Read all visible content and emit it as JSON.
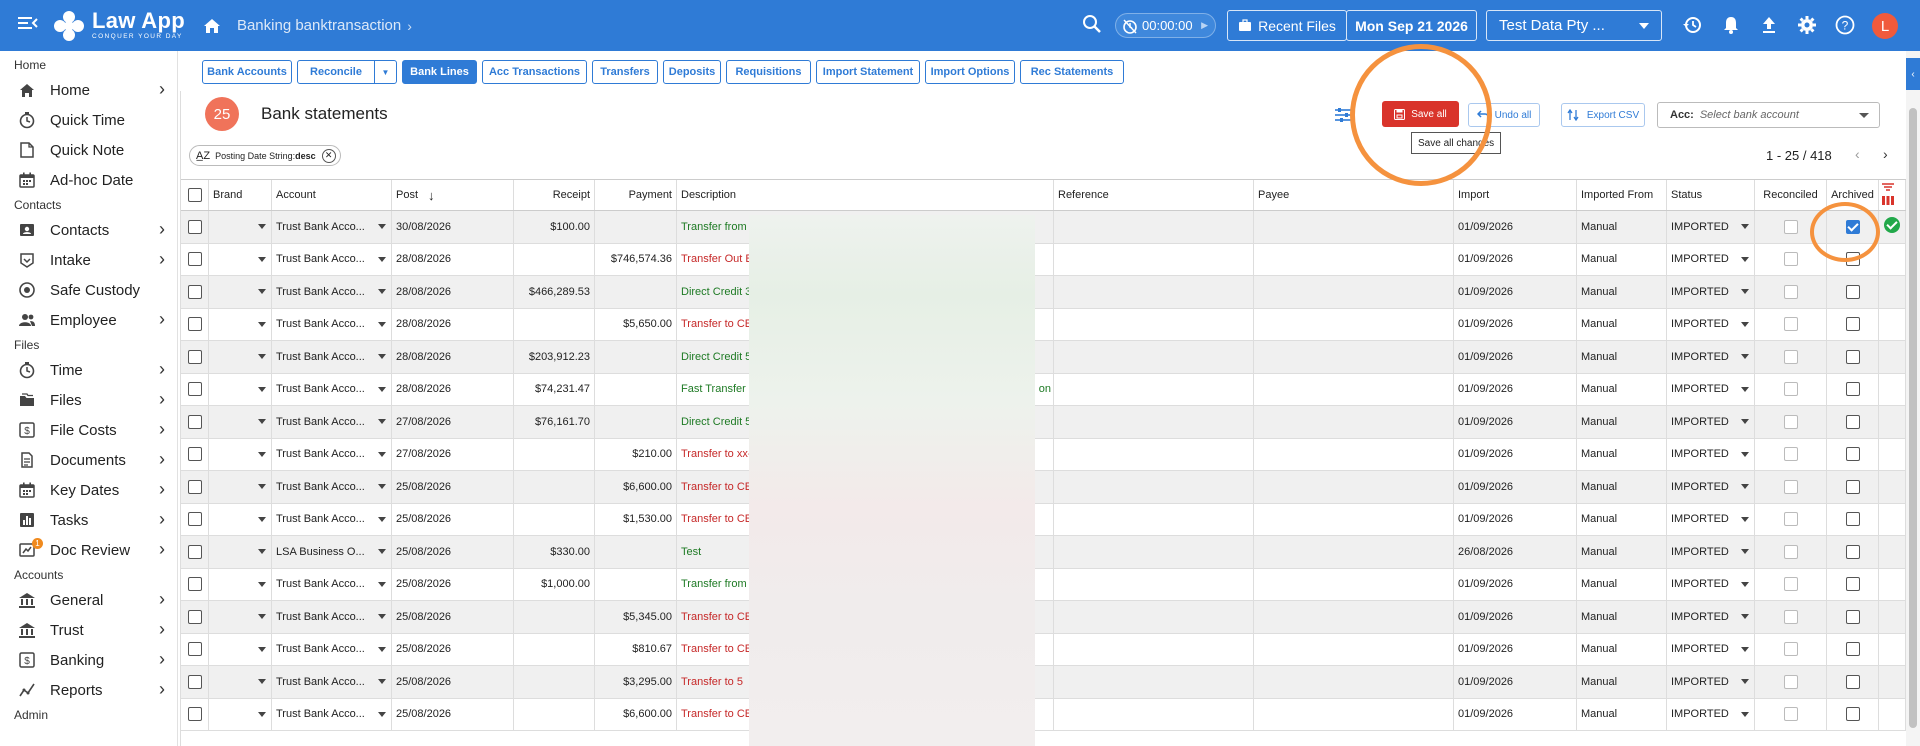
{
  "topbar": {
    "logo_name": "Law App",
    "logo_tagline": "CONQUER YOUR DAY",
    "breadcrumb": "Banking banktransaction",
    "timer": "00:00:00",
    "recent_files": "Recent Files",
    "date": "Mon Sep 21 2026",
    "company": "Test Data Pty ...",
    "avatar_initial": "L",
    "icons": [
      "menu-icon",
      "home-icon",
      "search-icon",
      "timer-icon",
      "history-icon",
      "bell-icon",
      "upload-icon",
      "gear-icon",
      "help-icon"
    ]
  },
  "sidebar": {
    "sections": [
      {
        "title": "Home",
        "items": [
          {
            "label": "Home",
            "icon": "home-icon",
            "chevron": true
          },
          {
            "label": "Quick Time",
            "icon": "stopwatch-icon",
            "chevron": false
          },
          {
            "label": "Quick Note",
            "icon": "note-icon",
            "chevron": false
          },
          {
            "label": "Ad-hoc Date",
            "icon": "calendar-icon",
            "chevron": false
          }
        ]
      },
      {
        "title": "Contacts",
        "items": [
          {
            "label": "Contacts",
            "icon": "contacts-icon",
            "chevron": true
          },
          {
            "label": "Intake",
            "icon": "intake-icon",
            "chevron": true
          },
          {
            "label": "Safe Custody",
            "icon": "safe-icon",
            "chevron": false
          },
          {
            "label": "Employee",
            "icon": "employee-icon",
            "chevron": true
          }
        ]
      },
      {
        "title": "Files",
        "items": [
          {
            "label": "Time",
            "icon": "stopwatch-icon",
            "chevron": true
          },
          {
            "label": "Files",
            "icon": "files-icon",
            "chevron": true
          },
          {
            "label": "File Costs",
            "icon": "dollar-icon",
            "chevron": true
          },
          {
            "label": "Documents",
            "icon": "document-icon",
            "chevron": true
          },
          {
            "label": "Key Dates",
            "icon": "calendar-icon",
            "chevron": true
          },
          {
            "label": "Tasks",
            "icon": "chart-icon",
            "chevron": true
          },
          {
            "label": "Doc Review",
            "icon": "review-icon",
            "chevron": true,
            "badge": "1"
          }
        ]
      },
      {
        "title": "Accounts",
        "items": [
          {
            "label": "General",
            "icon": "bank-icon",
            "chevron": true
          },
          {
            "label": "Trust",
            "icon": "bank-icon",
            "chevron": true
          },
          {
            "label": "Banking",
            "icon": "dollar-icon",
            "chevron": true
          },
          {
            "label": "Reports",
            "icon": "reports-icon",
            "chevron": true
          }
        ]
      },
      {
        "title": "Admin",
        "items": []
      }
    ]
  },
  "tabs": [
    {
      "label": "Bank Accounts",
      "active": false
    },
    {
      "label": "Reconcile",
      "active": false,
      "split": true
    },
    {
      "label": "Bank Lines",
      "active": true
    },
    {
      "label": "Acc Transactions",
      "active": false
    },
    {
      "label": "Transfers",
      "active": false
    },
    {
      "label": "Deposits",
      "active": false
    },
    {
      "label": "Requisitions",
      "active": false
    },
    {
      "label": "Import Statement",
      "active": false
    },
    {
      "label": "Import Options",
      "active": false
    },
    {
      "label": "Rec Statements",
      "active": false
    }
  ],
  "main": {
    "count": "25",
    "title": "Bank statements",
    "save_all": "Save all",
    "undo_all": "Undo all",
    "export_csv": "Export CSV",
    "acc_label": "Acc:",
    "acc_placeholder": "Select bank account",
    "tooltip": "Save all changes",
    "sort_chip_prefix": "Posting Date String:",
    "sort_chip_dir": "desc",
    "pager": "1 - 25 / 418"
  },
  "table": {
    "headers": [
      "Brand",
      "Account",
      "Post",
      "Receipt",
      "Payment",
      "Description",
      "Reference",
      "Payee",
      "Import",
      "Imported From",
      "Status",
      "Reconciled",
      "Archived"
    ],
    "rows": [
      {
        "account": "Trust Bank Acco...",
        "post": "30/08/2026",
        "receipt": "$100.00",
        "payment": "",
        "desc": "Transfer from",
        "type": "credit",
        "import": "01/09/2026",
        "from": "Manual",
        "status": "IMPORTED",
        "reconciled_disabled": true,
        "archived": true
      },
      {
        "account": "Trust Bank Acco...",
        "post": "28/08/2026",
        "receipt": "",
        "payment": "$746,574.36",
        "desc": "Transfer Out E",
        "type": "debit",
        "import": "01/09/2026",
        "from": "Manual",
        "status": "IMPORTED",
        "reconciled_disabled": true,
        "archived": false
      },
      {
        "account": "Trust Bank Acco...",
        "post": "28/08/2026",
        "receipt": "$466,289.53",
        "payment": "",
        "desc": "Direct Credit 3",
        "type": "credit",
        "import": "01/09/2026",
        "from": "Manual",
        "status": "IMPORTED",
        "reconciled_disabled": true,
        "archived": false
      },
      {
        "account": "Trust Bank Acco...",
        "post": "28/08/2026",
        "receipt": "",
        "payment": "$5,650.00",
        "desc": "Transfer to CE",
        "type": "debit",
        "import": "01/09/2026",
        "from": "Manual",
        "status": "IMPORTED",
        "reconciled_disabled": true,
        "archived": false
      },
      {
        "account": "Trust Bank Acco...",
        "post": "28/08/2026",
        "receipt": "$203,912.23",
        "payment": "",
        "desc": "Direct Credit 5",
        "type": "credit",
        "import": "01/09/2026",
        "from": "Manual",
        "status": "IMPORTED",
        "reconciled_disabled": true,
        "archived": false
      },
      {
        "account": "Trust Bank Acco...",
        "post": "28/08/2026",
        "receipt": "$74,231.47",
        "payment": "",
        "desc": "Fast Transfer",
        "type": "credit",
        "desc_tail": "on",
        "import": "01/09/2026",
        "from": "Manual",
        "status": "IMPORTED",
        "reconciled_disabled": true,
        "archived": false
      },
      {
        "account": "Trust Bank Acco...",
        "post": "27/08/2026",
        "receipt": "$76,161.70",
        "payment": "",
        "desc": "Direct Credit 5",
        "type": "credit",
        "import": "01/09/2026",
        "from": "Manual",
        "status": "IMPORTED",
        "reconciled_disabled": true,
        "archived": false
      },
      {
        "account": "Trust Bank Acco...",
        "post": "27/08/2026",
        "receipt": "",
        "payment": "$210.00",
        "desc": "Transfer to xx-",
        "type": "debit",
        "import": "01/09/2026",
        "from": "Manual",
        "status": "IMPORTED",
        "reconciled_disabled": true,
        "archived": false
      },
      {
        "account": "Trust Bank Acco...",
        "post": "25/08/2026",
        "receipt": "",
        "payment": "$6,600.00",
        "desc": "Transfer to CE",
        "type": "debit",
        "import": "01/09/2026",
        "from": "Manual",
        "status": "IMPORTED",
        "reconciled_disabled": true,
        "archived": false
      },
      {
        "account": "Trust Bank Acco...",
        "post": "25/08/2026",
        "receipt": "",
        "payment": "$1,530.00",
        "desc": "Transfer to CE",
        "type": "debit",
        "import": "01/09/2026",
        "from": "Manual",
        "status": "IMPORTED",
        "reconciled_disabled": true,
        "archived": false
      },
      {
        "account": "LSA Business O...",
        "post": "25/08/2026",
        "receipt": "$330.00",
        "payment": "",
        "desc": "Test",
        "type": "credit",
        "import": "26/08/2026",
        "from": "Manual",
        "status": "IMPORTED",
        "reconciled_disabled": true,
        "archived": false
      },
      {
        "account": "Trust Bank Acco...",
        "post": "25/08/2026",
        "receipt": "$1,000.00",
        "payment": "",
        "desc": "Transfer from",
        "type": "credit",
        "import": "01/09/2026",
        "from": "Manual",
        "status": "IMPORTED",
        "reconciled_disabled": true,
        "archived": false
      },
      {
        "account": "Trust Bank Acco...",
        "post": "25/08/2026",
        "receipt": "",
        "payment": "$5,345.00",
        "desc": "Transfer to CE",
        "type": "debit",
        "import": "01/09/2026",
        "from": "Manual",
        "status": "IMPORTED",
        "reconciled_disabled": true,
        "archived": false
      },
      {
        "account": "Trust Bank Acco...",
        "post": "25/08/2026",
        "receipt": "",
        "payment": "$810.67",
        "desc": "Transfer to CE",
        "type": "debit",
        "import": "01/09/2026",
        "from": "Manual",
        "status": "IMPORTED",
        "reconciled_disabled": true,
        "archived": false
      },
      {
        "account": "Trust Bank Acco...",
        "post": "25/08/2026",
        "receipt": "",
        "payment": "$3,295.00",
        "desc": "Transfer to 5",
        "type": "debit",
        "import": "01/09/2026",
        "from": "Manual",
        "status": "IMPORTED",
        "reconciled_disabled": true,
        "archived": false
      },
      {
        "account": "Trust Bank Acco...",
        "post": "25/08/2026",
        "receipt": "",
        "payment": "$6,600.00",
        "desc": "Transfer to CE",
        "type": "debit",
        "import": "01/09/2026",
        "from": "Manual",
        "status": "IMPORTED",
        "reconciled_disabled": true,
        "archived": false
      }
    ]
  },
  "colors": {
    "accent": "#2f7bd6",
    "save": "#d9342b",
    "credit": "#1e7a24",
    "debit": "#c62828",
    "highlight": "#f5923e"
  }
}
